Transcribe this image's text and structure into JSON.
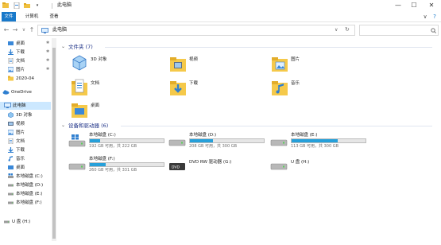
{
  "window": {
    "title": "此电脑",
    "quick_access_glyph": "▾",
    "minimize": "—",
    "maximize": "☐",
    "close": "✕"
  },
  "ribbon": {
    "tabs": [
      "文件",
      "计算机",
      "查看"
    ],
    "collapse_glyph": "∨",
    "help_glyph": "?"
  },
  "address": {
    "back": "←",
    "forward": "→",
    "recent": "∨",
    "up": "↑",
    "path": "此电脑",
    "dropdown_glyph": "∨",
    "refresh_glyph": "↻",
    "search_placeholder": ""
  },
  "sidebar": {
    "items": [
      {
        "label": "桌面",
        "icon": "desktop-icon",
        "pinned": true
      },
      {
        "label": "下载",
        "icon": "download-icon",
        "pinned": true
      },
      {
        "label": "文档",
        "icon": "document-icon",
        "pinned": true
      },
      {
        "label": "图片",
        "icon": "picture-icon",
        "pinned": true
      },
      {
        "label": "2020-04",
        "icon": "folder-icon",
        "pinned": false
      },
      {
        "label": "OneDrive",
        "icon": "cloud-icon",
        "pinned": false
      },
      {
        "label": "此电脑",
        "icon": "computer-icon",
        "pinned": false,
        "selected": true
      },
      {
        "label": "3D 对象",
        "icon": "cube-icon",
        "pinned": false
      },
      {
        "label": "视频",
        "icon": "video-icon",
        "pinned": false
      },
      {
        "label": "图片",
        "icon": "picture-icon",
        "pinned": false
      },
      {
        "label": "文档",
        "icon": "document-icon",
        "pinned": false
      },
      {
        "label": "下载",
        "icon": "download-icon",
        "pinned": false
      },
      {
        "label": "音乐",
        "icon": "music-icon",
        "pinned": false
      },
      {
        "label": "桌面",
        "icon": "desktop-icon",
        "pinned": false
      },
      {
        "label": "本地磁盘 (C:)",
        "icon": "windows-drive-icon",
        "pinned": false
      },
      {
        "label": "本地磁盘 (D:)",
        "icon": "drive-icon",
        "pinned": false
      },
      {
        "label": "本地磁盘 (E:)",
        "icon": "drive-icon",
        "pinned": false
      },
      {
        "label": "本地磁盘 (F:)",
        "icon": "drive-icon",
        "pinned": false
      },
      {
        "label": "U 盘 (H:)",
        "icon": "usb-drive-icon",
        "pinned": false
      }
    ],
    "pin_glyph": "✱"
  },
  "folders_group": {
    "title": "文件夹 (7)",
    "items": [
      {
        "name": "3D 对象",
        "icon": "cube-folder-icon"
      },
      {
        "name": "视频",
        "icon": "video-folder-icon"
      },
      {
        "name": "图片",
        "icon": "picture-folder-icon"
      },
      {
        "name": "文档",
        "icon": "document-folder-icon"
      },
      {
        "name": "下载",
        "icon": "download-folder-icon"
      },
      {
        "name": "音乐",
        "icon": "music-folder-icon"
      },
      {
        "name": "桌面",
        "icon": "desktop-folder-icon"
      }
    ]
  },
  "drives_group": {
    "title": "设备和驱动器 (6)",
    "items": [
      {
        "name": "本地磁盘 (C:)",
        "info": "192 GB 可用，共 222 GB",
        "used_fraction": 0.14,
        "icon": "windows-drive-icon",
        "bar": true
      },
      {
        "name": "本地磁盘 (D:)",
        "info": "208 GB 可用，共 300 GB",
        "used_fraction": 0.31,
        "icon": "drive-icon",
        "bar": true
      },
      {
        "name": "本地磁盘 (E:)",
        "info": "113 GB 可用，共 300 GB",
        "used_fraction": 0.62,
        "icon": "drive-icon",
        "bar": true
      },
      {
        "name": "本地磁盘 (F:)",
        "info": "260 GB 可用，共 331 GB",
        "used_fraction": 0.21,
        "icon": "drive-icon",
        "bar": true
      },
      {
        "name": "DVD RW 驱动器 (G:)",
        "info": "",
        "used_fraction": null,
        "icon": "dvd-drive-icon",
        "bar": false
      },
      {
        "name": "U 盘 (H:)",
        "info": "",
        "used_fraction": null,
        "icon": "usb-drive-icon",
        "bar": false
      }
    ]
  },
  "colors": {
    "accent": "#1979ca",
    "selection": "#cce8ff",
    "drive_bar": "#26a0da",
    "group_title": "#1e3287"
  }
}
